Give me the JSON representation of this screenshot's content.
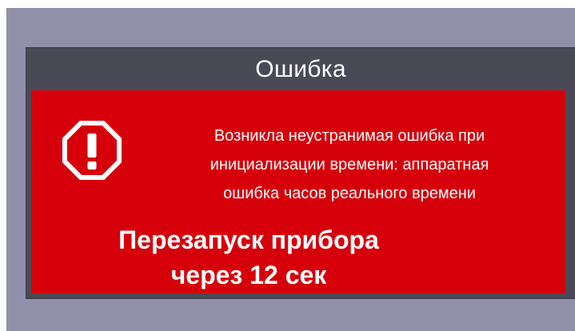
{
  "dialog": {
    "title": "Ошибка",
    "icon": "alert-octagon-icon",
    "message": "Возникла неустранимая ошибка при\nинициализации времени: аппаратная\nошибка часов реального времени",
    "restart_line1": "Перезапуск прибора",
    "restart_line2": "через 12 сек"
  },
  "colors": {
    "background": "#918fa9",
    "title_bar": "#4a4a56",
    "error_panel": "#d6000b",
    "text": "#ffffff"
  }
}
